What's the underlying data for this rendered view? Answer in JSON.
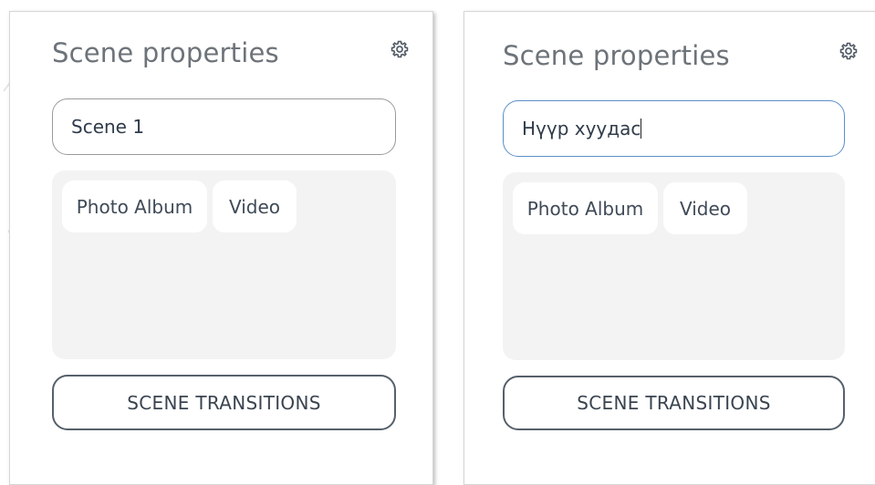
{
  "panels": [
    {
      "title": "Scene properties",
      "gear_icon": "gear-icon",
      "scene_name": "Scene 1",
      "media_buttons": [
        "Photo Album",
        "Video"
      ],
      "transitions_label": "SCENE TRANSITIONS",
      "input_focused": false
    },
    {
      "title": "Scene properties",
      "gear_icon": "gear-icon",
      "scene_name": "Нүүр хуудас",
      "media_buttons": [
        "Photo Album",
        "Video"
      ],
      "transitions_label": "SCENE TRANSITIONS",
      "input_focused": true
    }
  ],
  "colors": {
    "title_text": "#6d7379",
    "input_border": "#9a9a9a",
    "input_focus_border": "#5b8fc9",
    "media_area_bg": "#f3f3f3",
    "button_border": "#56606b"
  }
}
